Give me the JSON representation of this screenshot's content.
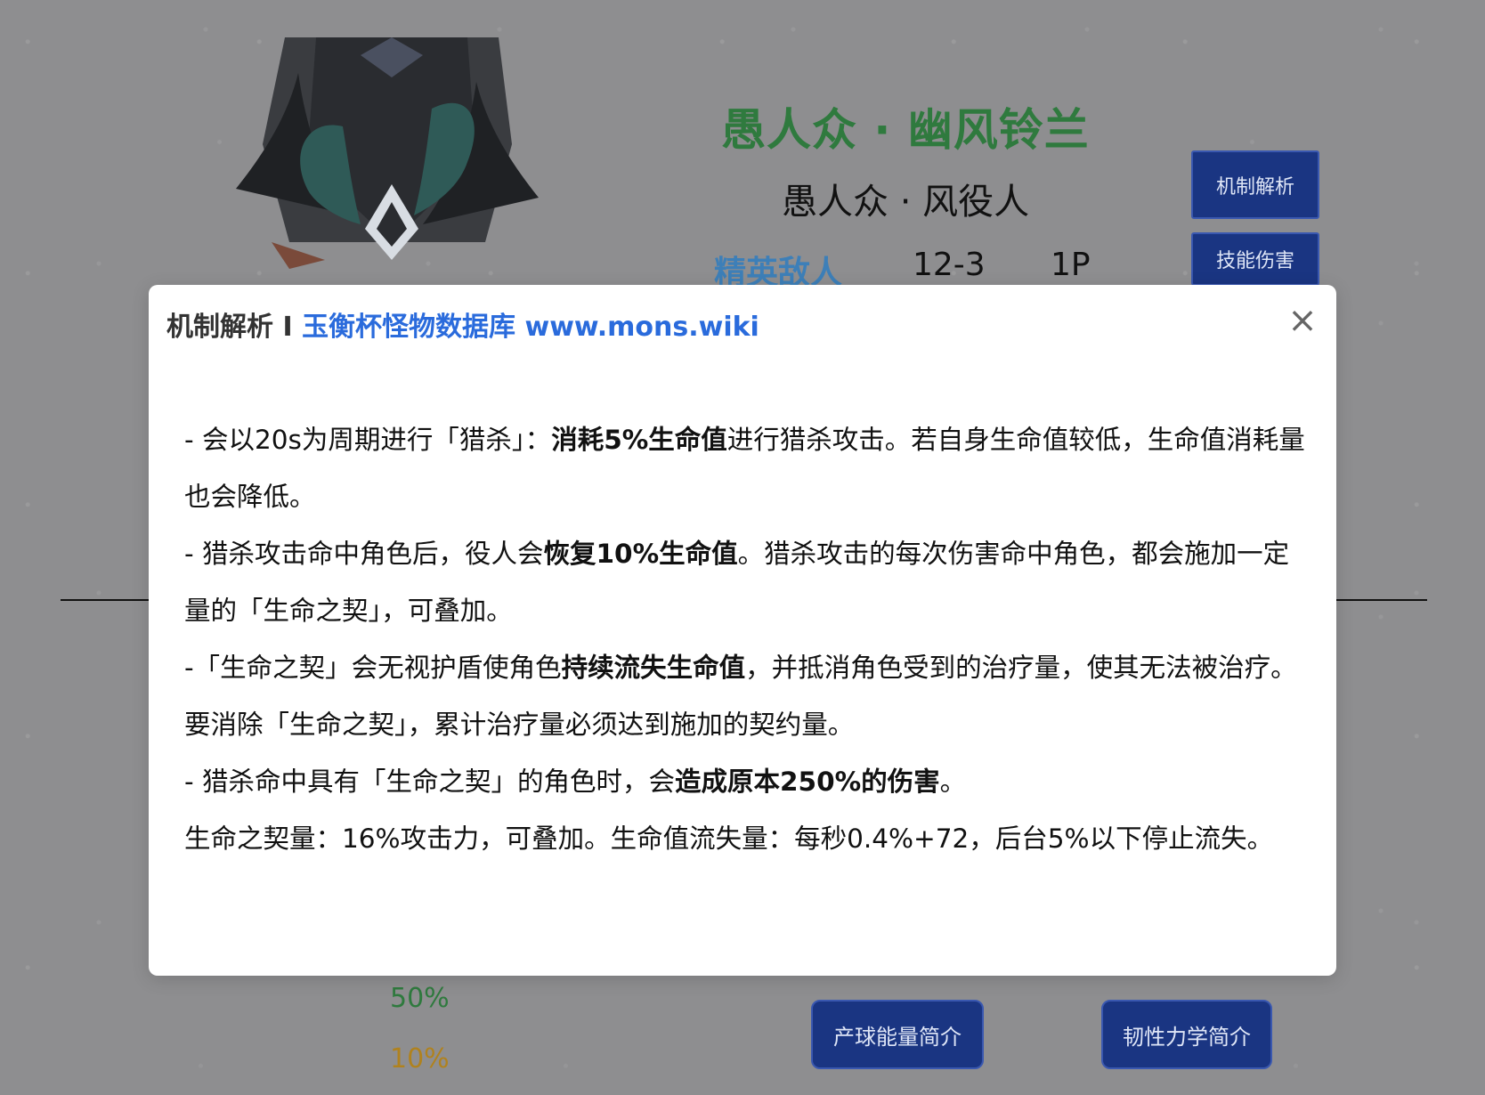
{
  "header": {
    "name_main": "愚人众 · 幽风铃兰",
    "name_sub": "愚人众 · 风役人",
    "enemy_type": "精英敌人",
    "level": "12-3",
    "player_count": "1P"
  },
  "side_buttons": {
    "mechanics": "机制解析",
    "skills": "技能伤害"
  },
  "stats": {
    "pct_green": "50%",
    "pct_gold": "10%"
  },
  "bottom_buttons": {
    "energy": "产球能量简介",
    "toughness": "韧性力学简介"
  },
  "modal": {
    "title_prefix": "机制解析 I ",
    "title_link": "玉衡杯怪物数据库 www.mons.wiki",
    "close_label": "×",
    "paragraphs": [
      {
        "parts": [
          {
            "text": "- 会以20s为周期进行「猎杀」：",
            "bold": false
          },
          {
            "text": "消耗5%生命值",
            "bold": true
          },
          {
            "text": "进行猎杀攻击。若自身生命值较低，生命值消耗量也会降低。",
            "bold": false
          }
        ]
      },
      {
        "parts": [
          {
            "text": "- 猎杀攻击命中角色后，役人会",
            "bold": false
          },
          {
            "text": "恢复10%生命值",
            "bold": true
          },
          {
            "text": "。猎杀攻击的每次伤害命中角色，都会施加一定量的「生命之契」，可叠加。",
            "bold": false
          }
        ]
      },
      {
        "parts": [
          {
            "text": "-「生命之契」会无视护盾使角色",
            "bold": false
          },
          {
            "text": "持续流失生命值",
            "bold": true
          },
          {
            "text": "，并抵消角色受到的治疗量，使其无法被治疗。要消除「生命之契」，累计治疗量必须达到施加的契约量。",
            "bold": false
          }
        ]
      },
      {
        "parts": [
          {
            "text": "- 猎杀命中具有「生命之契」的角色时，会",
            "bold": false
          },
          {
            "text": "造成原本250%的伤害",
            "bold": true
          },
          {
            "text": "。",
            "bold": false
          }
        ]
      },
      {
        "parts": [
          {
            "text": "生命之契量：16%攻击力，可叠加。生命值流失量：每秒0.4%+72，后台5%以下停止流失。",
            "bold": false
          }
        ]
      }
    ]
  }
}
